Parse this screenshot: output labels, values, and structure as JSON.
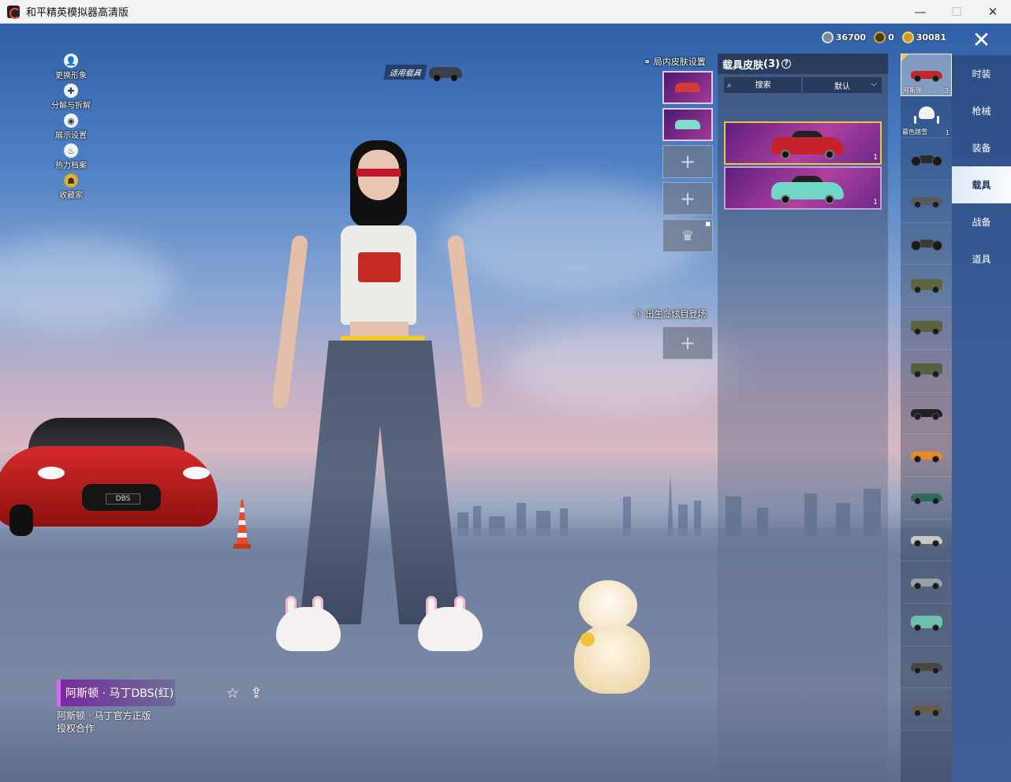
{
  "window": {
    "title": "和平精英模拟器高清版",
    "minimize": "—",
    "maximize": "☐",
    "close": "✕"
  },
  "side_menu": [
    {
      "label": "更换形象",
      "icon": "person-icon",
      "glyph": "👤"
    },
    {
      "label": "分解与拆解",
      "icon": "puzzle-icon",
      "glyph": "✚"
    },
    {
      "label": "展示设置",
      "icon": "eye-icon",
      "glyph": "◉"
    },
    {
      "label": "热力档案",
      "icon": "flame-icon",
      "glyph": "♨"
    },
    {
      "label": "收藏家",
      "icon": "collector-badge-icon",
      "glyph": "☗"
    }
  ],
  "apply_tag": {
    "label": "适用载具"
  },
  "currency": [
    {
      "value": "36700",
      "icon": "silver-coin-icon"
    },
    {
      "value": "0",
      "icon": "ring-coin-icon"
    },
    {
      "value": "30081",
      "icon": "gold-coin-icon"
    }
  ],
  "close_label": "✕",
  "categories": [
    {
      "label": "时装",
      "active": false
    },
    {
      "label": "枪械",
      "active": false
    },
    {
      "label": "装备",
      "active": false
    },
    {
      "label": "载具",
      "active": true
    },
    {
      "label": "战备",
      "active": false
    },
    {
      "label": "道具",
      "active": false
    }
  ],
  "vehicle_list": [
    {
      "caption": "阿斯顿 · …",
      "count": "2",
      "kind": "sports",
      "color": "#c62424",
      "selected": true
    },
    {
      "caption": "暮色踏雪",
      "count": "1",
      "kind": "horse",
      "color": "#f2f2f2",
      "selected": false
    },
    {
      "caption": "",
      "count": "",
      "kind": "moto",
      "color": "#2b2b2b",
      "selected": false
    },
    {
      "caption": "",
      "count": "",
      "kind": "buggy",
      "color": "#555a60",
      "selected": false
    },
    {
      "caption": "",
      "count": "",
      "kind": "moto",
      "color": "#3a3a3a",
      "selected": false
    },
    {
      "caption": "",
      "count": "",
      "kind": "jeep",
      "color": "#5d6640",
      "selected": false
    },
    {
      "caption": "",
      "count": "",
      "kind": "jeep",
      "color": "#5a6242",
      "selected": false
    },
    {
      "caption": "",
      "count": "",
      "kind": "jeep",
      "color": "#55603e",
      "selected": false
    },
    {
      "caption": "",
      "count": "",
      "kind": "monster",
      "color": "#1f2228",
      "selected": false
    },
    {
      "caption": "",
      "count": "",
      "kind": "sedan",
      "color": "#e88a2a",
      "selected": false
    },
    {
      "caption": "",
      "count": "",
      "kind": "sedan",
      "color": "#2b6b5e",
      "selected": false
    },
    {
      "caption": "",
      "count": "",
      "kind": "sedan",
      "color": "#c7c7c7",
      "selected": false
    },
    {
      "caption": "",
      "count": "",
      "kind": "sedan",
      "color": "#9aa0a8",
      "selected": false
    },
    {
      "caption": "",
      "count": "",
      "kind": "van",
      "color": "#6fbfb0",
      "selected": false
    },
    {
      "caption": "",
      "count": "",
      "kind": "pickup",
      "color": "#4a4540",
      "selected": false
    },
    {
      "caption": "",
      "count": "",
      "kind": "pickup",
      "color": "#6a5a48",
      "selected": false
    }
  ],
  "skin_panel": {
    "title": "载具皮肤",
    "count": "(3)",
    "help": "?",
    "search_placeholder": "搜索",
    "sort_label": "默认",
    "cards": [
      {
        "tag": "",
        "count": "1",
        "color": "#c5232c"
      },
      {
        "tag": "",
        "count": "1",
        "color": "#6fd6c8"
      }
    ]
  },
  "slots": {
    "ingame_label": "局内皮肤设置",
    "spawn_label": "出生岛炫目登场",
    "add_glyph": "+",
    "crown_glyph": "♛",
    "filled": [
      {
        "color": "#d23a3a"
      },
      {
        "color": "#7fdccf"
      }
    ]
  },
  "feature_car": {
    "plate": "DBS"
  },
  "item": {
    "name": "阿斯顿 · 马丁DBS(红)",
    "desc_line1": "阿斯顿 · 马丁官方正版",
    "desc_line2": "授权合作",
    "favorite_glyph": "☆",
    "share_glyph": "⇪"
  },
  "colors": {
    "accent_gold": "#f0c24a",
    "legendary_purple": "#a33a98",
    "tab_active": "#f8fbff"
  }
}
